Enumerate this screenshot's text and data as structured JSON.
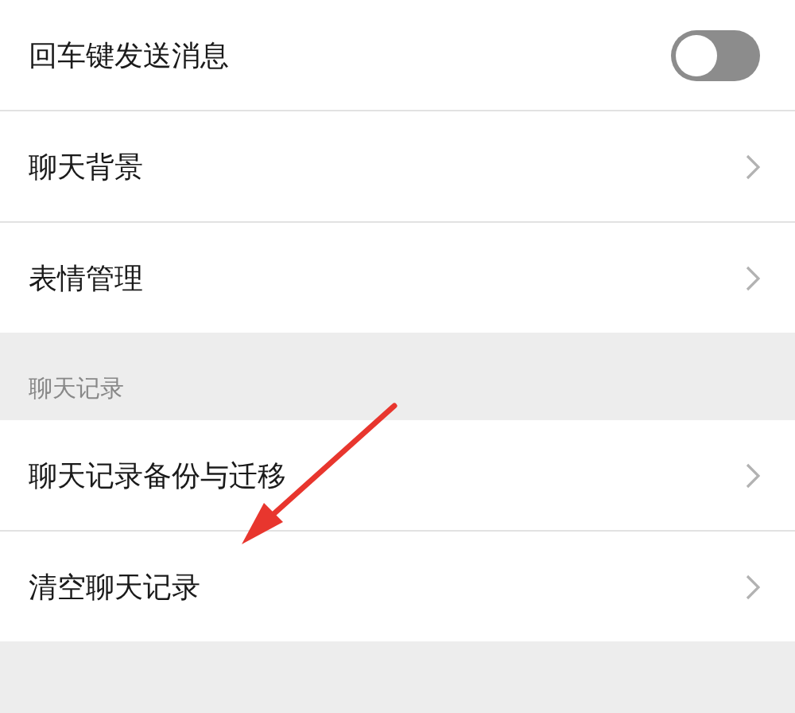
{
  "settings_top": [
    {
      "kind": "toggle",
      "label": "回车键发送消息",
      "on": false
    },
    {
      "kind": "link",
      "label": "聊天背景"
    },
    {
      "kind": "link",
      "label": "表情管理"
    }
  ],
  "section": {
    "title": "聊天记录",
    "items": [
      {
        "kind": "link",
        "label": "聊天记录备份与迁移"
      },
      {
        "kind": "link",
        "label": "清空聊天记录"
      }
    ]
  },
  "annotation": {
    "kind": "arrow"
  }
}
